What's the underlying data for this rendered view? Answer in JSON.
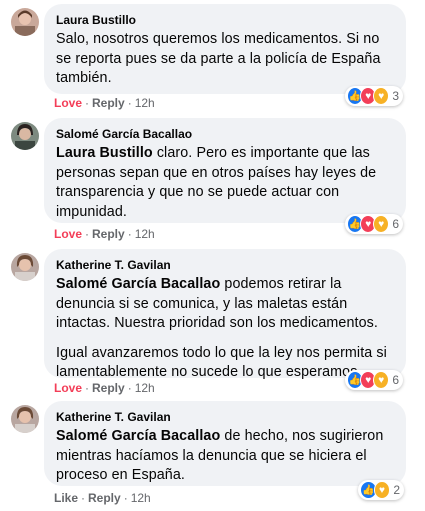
{
  "comments": [
    {
      "author": "Laura Bustillo",
      "body_parts": [
        {
          "text": "Salo, nosotros queremos los medicamentos. Si no se reporta pues se da parte a la policía de España también."
        }
      ],
      "action_react": "Love",
      "action_reply": "Reply",
      "time": "12h",
      "reaction_count": "3"
    },
    {
      "author": "Salomé García Bacallao",
      "mention": "Laura Bustillo",
      "body": "claro. Pero es importante que las personas sepan que en otros países hay leyes de transparencia y que no se puede actuar con impunidad.",
      "action_react": "Love",
      "action_reply": "Reply",
      "time": "12h",
      "reaction_count": "6"
    },
    {
      "author": "Katherine T. Gavilan",
      "mention": "Salomé García Bacallao",
      "body": "podemos retirar la denuncia si se comunica, y las maletas están intactas. Nuestra prioridad son los medicamentos.",
      "body2": "Igual avanzaremos todo lo que la ley nos permita si lamentablemente no sucede lo que esperamos.",
      "action_react": "Love",
      "action_reply": "Reply",
      "time": "12h",
      "reaction_count": "6"
    },
    {
      "author": "Katherine T. Gavilan",
      "mention": "Salomé García Bacallao",
      "body": "de hecho, nos sugirieron mientras hacíamos la denuncia que se hiciera el proceso en España.",
      "action_react": "Like",
      "action_reply": "Reply",
      "time": "12h",
      "reaction_count": "2"
    }
  ],
  "colors": {
    "bubble": "#f0f2f5",
    "love": "#f33e58",
    "like": "#1877f2",
    "care": "#f7b125",
    "meta": "#65676b"
  },
  "icons": [
    "like-reaction-icon",
    "love-reaction-icon",
    "care-reaction-icon",
    "avatar"
  ]
}
